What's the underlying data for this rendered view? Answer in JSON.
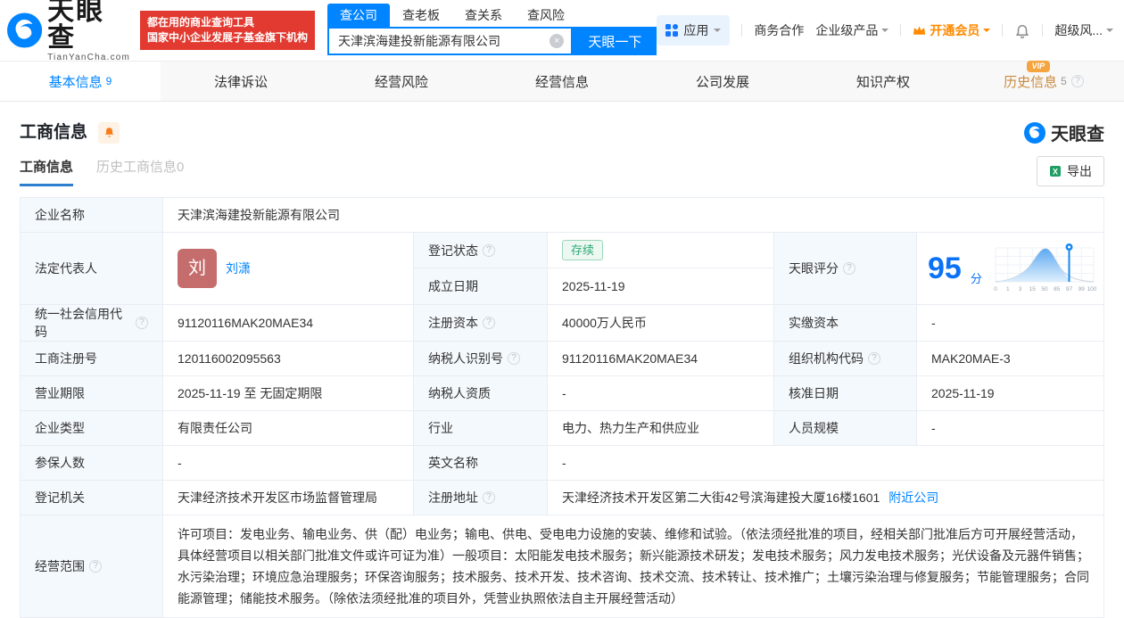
{
  "header": {
    "logo": {
      "title": "天眼查",
      "subtitle": "TianYanCha.com"
    },
    "badge": {
      "line1": "都在用的商业查询工具",
      "line2": "国家中小企业发展子基金旗下机构"
    },
    "search": {
      "tabs": [
        {
          "label": "查公司",
          "active": true
        },
        {
          "label": "查老板",
          "active": false
        },
        {
          "label": "查关系",
          "active": false
        },
        {
          "label": "查风险",
          "active": false
        }
      ],
      "value": "天津滨海建投新能源有限公司",
      "button": "天眼一下"
    },
    "nav": {
      "apps": "应用",
      "biz": "商务合作",
      "enterprise": "企业级产品",
      "member": "开通会员",
      "risk": "超级风..."
    }
  },
  "tabs": [
    {
      "label": "基本信息",
      "count": "9"
    },
    {
      "label": "法律诉讼",
      "count": ""
    },
    {
      "label": "经营风险",
      "count": ""
    },
    {
      "label": "经营信息",
      "count": ""
    },
    {
      "label": "公司发展",
      "count": ""
    },
    {
      "label": "知识产权",
      "count": ""
    },
    {
      "label": "历史信息",
      "count": "5",
      "vip": "VIP"
    }
  ],
  "section": {
    "title": "工商信息",
    "brand": "天眼查",
    "subtabs": [
      {
        "label": "工商信息"
      },
      {
        "label": "历史工商信息0"
      }
    ],
    "export_label": "导出"
  },
  "table": {
    "company_name_label": "企业名称",
    "company_name": "天津滨海建投新能源有限公司",
    "legal_rep_label": "法定代表人",
    "legal_rep_avatar": "刘",
    "legal_rep_name": "刘潇",
    "reg_status_label": "登记状态",
    "reg_status": "存续",
    "est_date_label": "成立日期",
    "est_date": "2025-11-19",
    "score_label": "天眼评分",
    "score": "95",
    "score_unit": "分",
    "score_axis": [
      "0",
      "1",
      "3",
      "15",
      "50",
      "85",
      "97",
      "99",
      "100"
    ],
    "credit_code_label": "统一社会信用代码",
    "credit_code": "91120116MAK20MAE34",
    "reg_capital_label": "注册资本",
    "reg_capital": "40000万人民币",
    "paid_capital_label": "实缴资本",
    "paid_capital": "-",
    "reg_number_label": "工商注册号",
    "reg_number": "120116002095563",
    "taxpayer_id_label": "纳税人识别号",
    "taxpayer_id": "91120116MAK20MAE34",
    "org_code_label": "组织机构代码",
    "org_code": "MAK20MAE-3",
    "term_label": "营业期限",
    "term": "2025-11-19 至 无固定期限",
    "taxpayer_quality_label": "纳税人资质",
    "taxpayer_quality": "-",
    "approve_date_label": "核准日期",
    "approve_date": "2025-11-19",
    "company_type_label": "企业类型",
    "company_type": "有限责任公司",
    "industry_label": "行业",
    "industry": "电力、热力生产和供应业",
    "staff_size_label": "人员规模",
    "staff_size": "-",
    "insured_label": "参保人数",
    "insured": "-",
    "english_name_label": "英文名称",
    "english_name": "-",
    "authority_label": "登记机关",
    "authority": "天津经济技术开发区市场监督管理局",
    "address_label": "注册地址",
    "address": "天津经济技术开发区第二大街42号滨海建投大厦16楼1601",
    "nearby_link": "附近公司",
    "scope_label": "经营范围",
    "scope": "许可项目：发电业务、输电业务、供（配）电业务；输电、供电、受电电力设施的安装、维修和试验。（依法须经批准的项目，经相关部门批准后方可开展经营活动，具体经营项目以相关部门批准文件或许可证为准）一般项目：太阳能发电技术服务；新兴能源技术研发；发电技术服务；风力发电技术服务；光伏设备及元器件销售；水污染治理；环境应急治理服务；环保咨询服务；技术服务、技术开发、技术咨询、技术交流、技术转让、技术推广；土壤污染治理与修复服务；节能管理服务；合同能源管理；储能技术服务。（除依法须经批准的项目外，凭营业执照依法自主开展经营活动）"
  },
  "colors": {
    "brand_blue": "#0084ff",
    "slogan_red": "#e23a30",
    "member_orange": "#ff8a00",
    "status_green": "#2fa873",
    "history_orange": "#ca8a3f",
    "label_bg": "#f4f9fd",
    "score_blue": "#0b72f8"
  }
}
